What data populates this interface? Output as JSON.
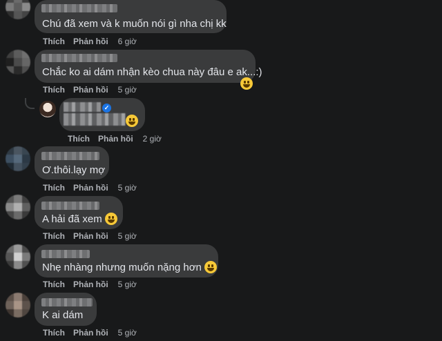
{
  "comments": [
    {
      "text": "Chú đã xem và k muốn nói gì nha chị kk",
      "emoji": null,
      "actions": {
        "like": "Thích",
        "reply": "Phản hồi",
        "time": "6 giờ"
      }
    },
    {
      "text": "Chắc ko ai dám nhận kèo chua này đâu e ak...:)",
      "emoji": "grinning-sweat-emoji",
      "actions": {
        "like": "Thích",
        "reply": "Phản hồi",
        "time": "5 giờ"
      }
    },
    {
      "text": "Ơ.thôi.lạy mợ",
      "emoji": null,
      "actions": {
        "like": "Thích",
        "reply": "Phản hồi",
        "time": "5 giờ"
      }
    },
    {
      "text": "A hải đã xem",
      "emoji": "laughing-emoji",
      "actions": {
        "like": "Thích",
        "reply": "Phản hồi",
        "time": "5 giờ"
      }
    },
    {
      "text": "Nhẹ nhàng nhưng muốn nặng hơn",
      "emoji": "smirk-emoji",
      "actions": {
        "like": "Thích",
        "reply": "Phản hồi",
        "time": "5 giờ"
      }
    },
    {
      "text": "K ai dám",
      "emoji": null,
      "actions": {
        "like": "Thích",
        "reply": "Phản hồi",
        "time": "5 giờ"
      }
    }
  ],
  "reply": {
    "emoji": "rofl-emoji",
    "actions": {
      "like": "Thích",
      "reply": "Phản hồi",
      "time": "2 giờ"
    }
  },
  "colors": {
    "background": "#18191a",
    "bubble": "#3a3b3c",
    "text": "#e4e6eb",
    "secondary_text": "#b0b3b8",
    "verified": "#1b74e4",
    "emoji": "#f7c938"
  }
}
